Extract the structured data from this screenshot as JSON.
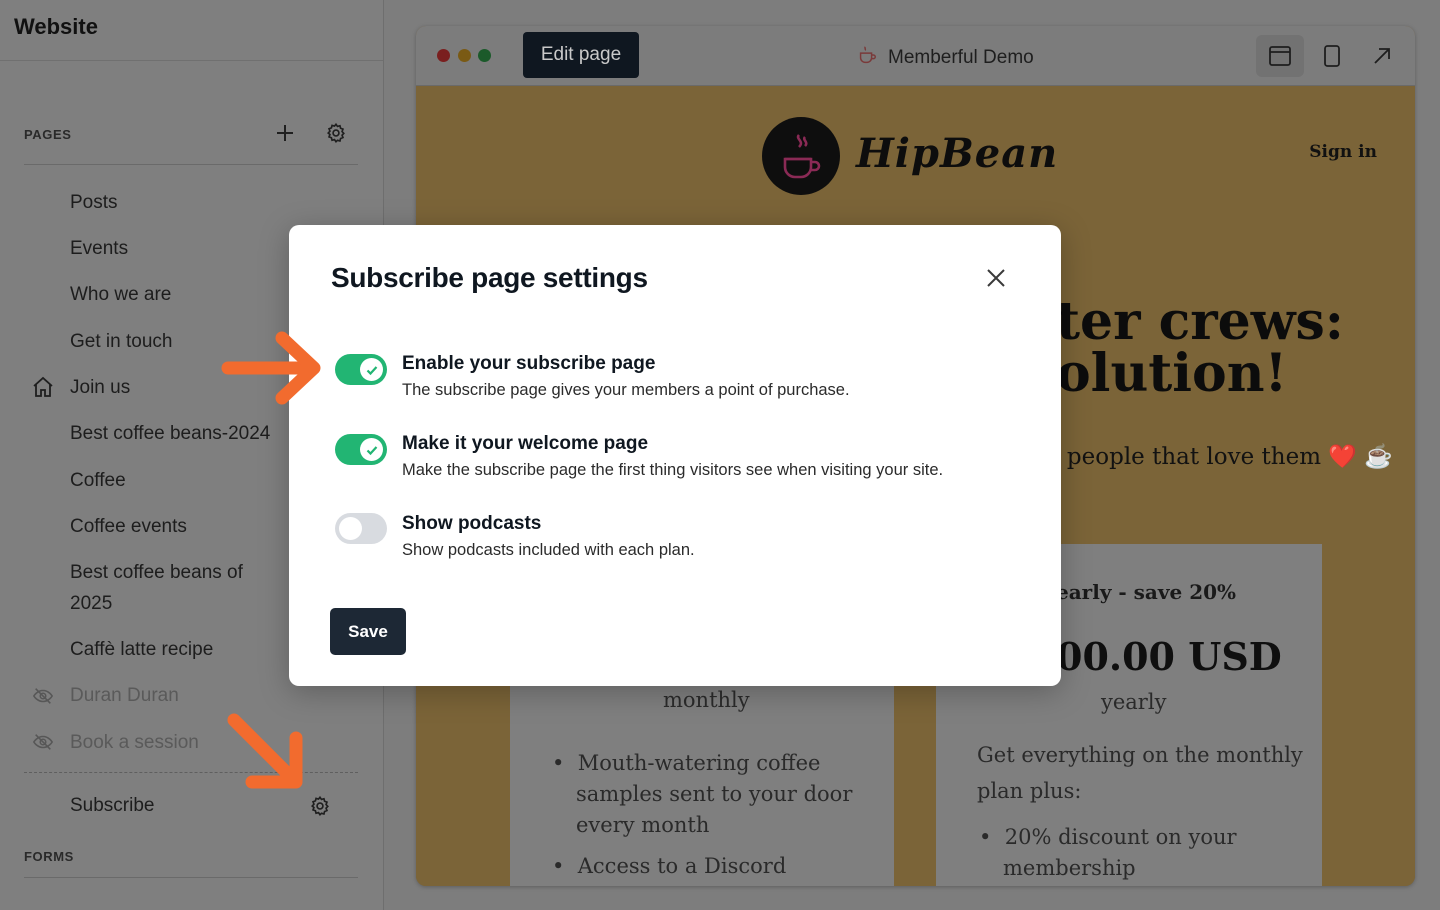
{
  "sidebar": {
    "title": "Website",
    "pages_heading": "PAGES",
    "forms_heading": "FORMS",
    "pages": [
      {
        "label": "Posts"
      },
      {
        "label": "Events"
      },
      {
        "label": "Who we are"
      },
      {
        "label": "Get in touch"
      },
      {
        "label": "Join us",
        "icon": "home-icon"
      },
      {
        "label": "Best coffee beans-2024"
      },
      {
        "label": "Coffee"
      },
      {
        "label": "Coffee events"
      },
      {
        "label": "Best coffee beans of"
      },
      {
        "label": "2025"
      },
      {
        "label": "Caffè latte recipe"
      },
      {
        "label": "Duran Duran",
        "icon": "eye-slash-icon"
      },
      {
        "label": "Book a session",
        "icon": "eye-slash-icon"
      },
      {
        "label": "Subscribe"
      }
    ]
  },
  "preview": {
    "edit_button": "Edit page",
    "site_name": "Memberful Demo",
    "site": {
      "logo_text": "HipBean",
      "sign_in": "Sign in",
      "hero_line1": "ter crews:",
      "hero_line2": "olution!",
      "tagline": "e people that love them ❤️ ☕",
      "plan_right_title": "early - save 20%",
      "plan_right_price": "00.00 USD",
      "plan_right_period": "yearly",
      "plan_left_period": "monthly",
      "left_bullets": [
        "Mouth-watering coffee",
        "samples sent to your door",
        "every month",
        "Access to a Discord"
      ],
      "right_desc_1": "Get everything on the monthly",
      "right_desc_2": "plan plus:",
      "right_bullets": [
        "20% discount on your",
        "membership"
      ]
    }
  },
  "modal": {
    "title": "Subscribe page settings",
    "options": [
      {
        "title": "Enable your subscribe page",
        "description": "The subscribe page gives your members a point of purchase.",
        "enabled": true
      },
      {
        "title": "Make it your welcome page",
        "description": "Make the subscribe page the first thing visitors see when visiting your site.",
        "enabled": true
      },
      {
        "title": "Show podcasts",
        "description": "Show podcasts included with each plan.",
        "enabled": false
      }
    ],
    "save_label": "Save"
  },
  "colors": {
    "accent_green": "#22b573",
    "annotation_orange": "#f26b2e",
    "dark_button": "#1d2835"
  }
}
